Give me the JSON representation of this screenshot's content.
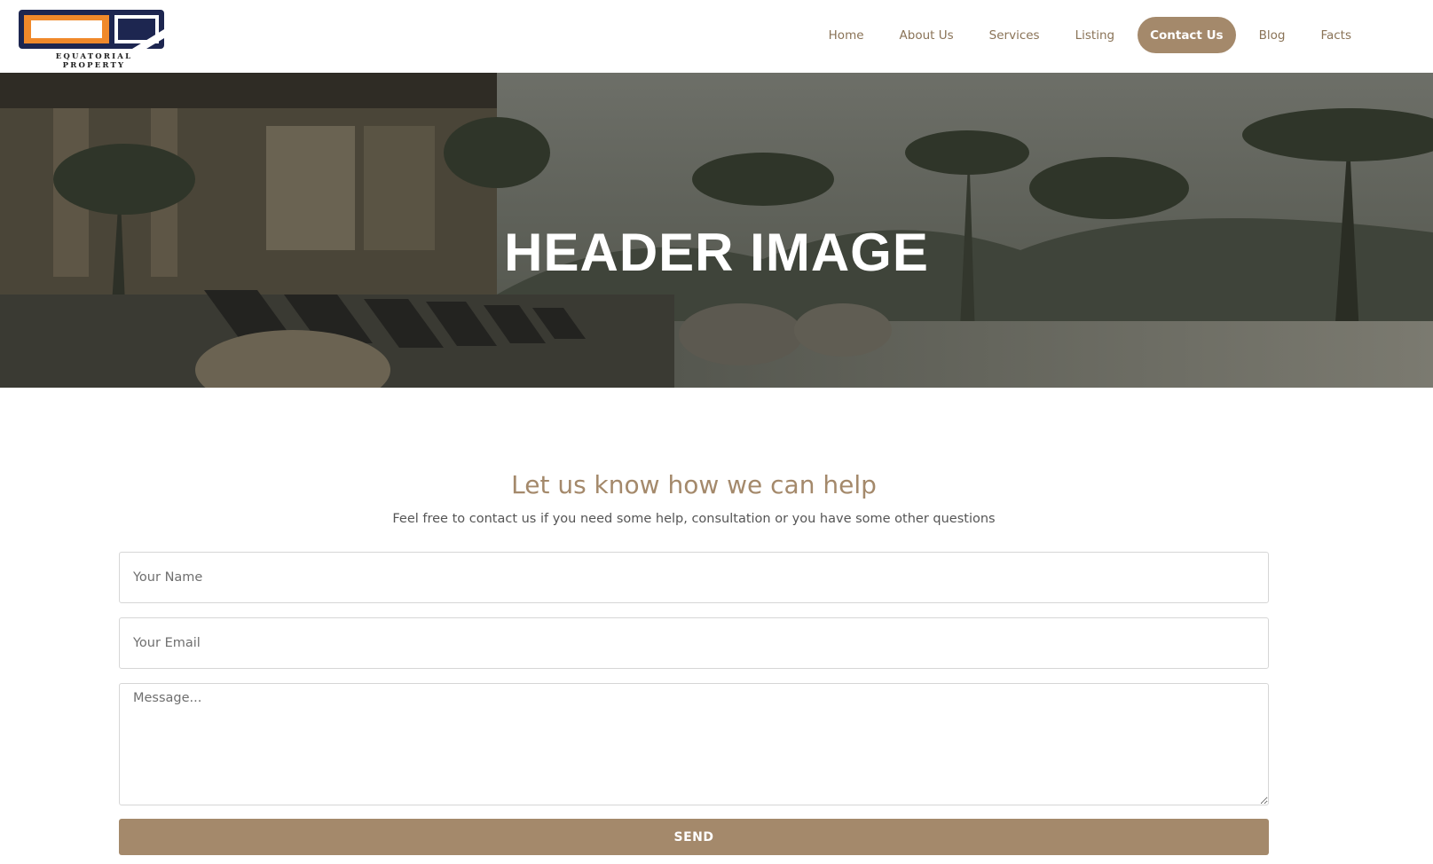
{
  "brand": {
    "name": "EQUATORIAL PROPERTY",
    "colors": {
      "orange": "#f0892a",
      "navy": "#1d2650",
      "accent": "#a4896b"
    }
  },
  "nav": {
    "items": [
      {
        "label": "Home",
        "active": false
      },
      {
        "label": "About Us",
        "active": false
      },
      {
        "label": "Services",
        "active": false
      },
      {
        "label": "Listing",
        "active": false
      },
      {
        "label": "Contact Us",
        "active": true
      },
      {
        "label": "Blog",
        "active": false
      },
      {
        "label": "Facts",
        "active": false
      }
    ]
  },
  "hero": {
    "title": "HEADER IMAGE"
  },
  "contact": {
    "heading": "Let us know how we can help",
    "subheading": "Feel free to contact us if you need some help, consultation or you have some other questions",
    "name_placeholder": "Your Name",
    "email_placeholder": "Your Email",
    "message_placeholder": "Message...",
    "send_label": "SEND"
  }
}
